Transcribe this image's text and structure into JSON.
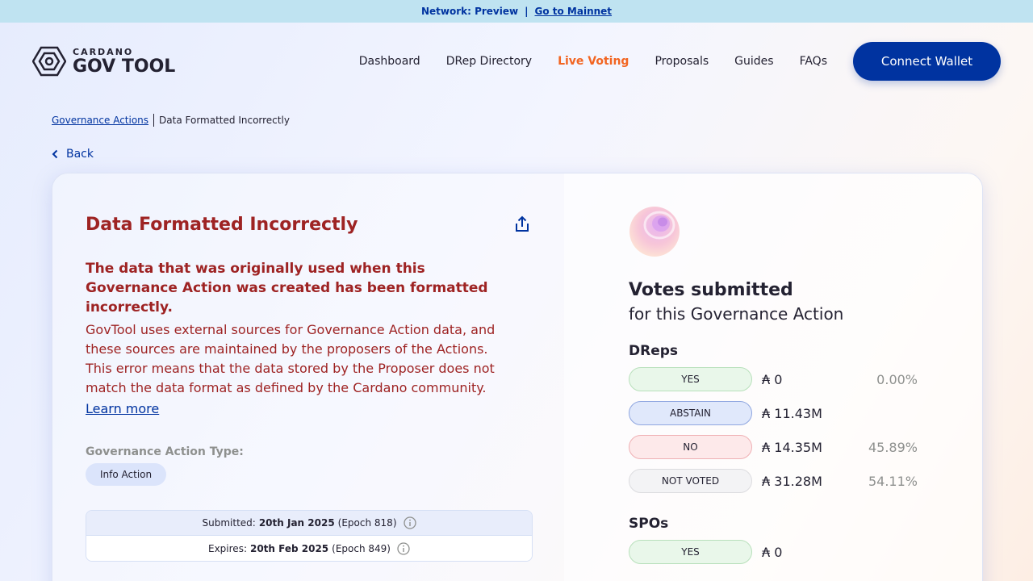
{
  "topbar": {
    "network": "Network: Preview",
    "separator": "|",
    "link": "Go to Mainnet"
  },
  "logo": {
    "small": "CARDANO",
    "big": "GOV TOOL"
  },
  "nav": {
    "items": [
      "Dashboard",
      "DRep Directory",
      "Live Voting",
      "Proposals",
      "Guides",
      "FAQs"
    ],
    "active": "Live Voting",
    "connect": "Connect Wallet"
  },
  "breadcrumb": {
    "parent": "Governance Actions",
    "current": "Data Formatted Incorrectly"
  },
  "back": "Back",
  "action": {
    "title": "Data Formatted Incorrectly",
    "error_heading": "The data that was originally used when this Governance Action was created has been formatted incorrectly.",
    "error_body": "GovTool uses external sources for Governance Action data, and these sources are maintained by the proposers of the Actions. This error means that the data stored by the Proposer does not match the data format as defined by the Cardano community.",
    "learn_more": "Learn more",
    "type_label": "Governance Action Type:",
    "type_value": "Info Action",
    "submitted_label": "Submitted:",
    "submitted_date": "20th Jan 2025",
    "submitted_epoch": "(Epoch 818)",
    "expires_label": "Expires:",
    "expires_date": "20th Feb 2025",
    "expires_epoch": "(Epoch 849)"
  },
  "votes": {
    "title": "Votes submitted",
    "subtitle": "for this Governance Action",
    "dreps": {
      "label": "DReps",
      "rows": [
        {
          "option": "YES",
          "amount": "₳ 0",
          "percent": "0.00%"
        },
        {
          "option": "ABSTAIN",
          "amount": "₳ 11.43M",
          "percent": ""
        },
        {
          "option": "NO",
          "amount": "₳ 14.35M",
          "percent": "45.89%"
        },
        {
          "option": "NOT VOTED",
          "amount": "₳ 31.28M",
          "percent": "54.11%"
        }
      ]
    },
    "spos": {
      "label": "SPOs",
      "rows": [
        {
          "option": "YES",
          "amount": "₳ 0",
          "percent": ""
        }
      ]
    }
  },
  "colors": {
    "brand": "#0033a0",
    "active_nav": "#f26522",
    "error": "#9e2323"
  }
}
